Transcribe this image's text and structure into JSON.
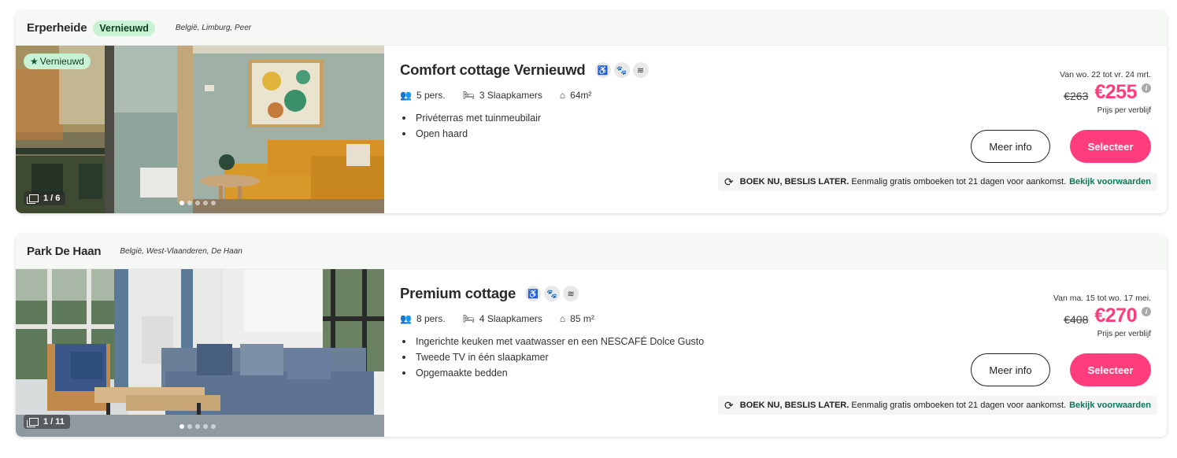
{
  "listings": [
    {
      "park_name": "Erperheide",
      "park_badge": "Vernieuwd",
      "location": [
        "België",
        "Limburg",
        "Peer"
      ],
      "photo_badge": "Vernieuwd",
      "photo_counter": "1 / 6",
      "title": "Comfort cottage Vernieuwd",
      "amenity_icons": [
        "wheelchair-icon",
        "pet-paw-icon",
        "wifi-icon"
      ],
      "persons": "5 pers.",
      "bedrooms": "3 Slaapkamers",
      "area": "64m²",
      "features": [
        "Privéterras met tuinmeubilair",
        "Open haard"
      ],
      "dates": "Van wo. 22 tot vr. 24 mrt.",
      "old_price": "€263",
      "new_price": "€255",
      "per_stay": "Prijs per verblijf",
      "more_info": "Meer info",
      "select": "Selecteer",
      "book_bold": "BOEK NU, BESLIS LATER.",
      "book_text": "Eenmalig gratis omboeken tot 21 dagen voor aankomst.",
      "book_link": "Bekijk voorwaarden"
    },
    {
      "park_name": "Park De Haan",
      "location": [
        "België",
        "West-Vlaanderen",
        "De Haan"
      ],
      "photo_counter": "1 / 11",
      "title": "Premium cottage",
      "amenity_icons": [
        "wheelchair-icon",
        "pet-paw-icon",
        "wifi-icon"
      ],
      "persons": "8 pers.",
      "bedrooms": "4 Slaapkamers",
      "area": "85 m²",
      "features": [
        "Ingerichte keuken met vaatwasser en een NESCAFÉ Dolce Gusto",
        "Tweede TV in één slaapkamer",
        "Opgemaakte bedden"
      ],
      "dates": "Van ma. 15 tot wo. 17 mei.",
      "old_price": "€408",
      "new_price": "€270",
      "per_stay": "Prijs per verblijf",
      "more_info": "Meer info",
      "select": "Selecteer",
      "book_bold": "BOEK NU, BESLIS LATER.",
      "book_text": "Eenmalig gratis omboeken tot 21 dagen voor aankomst.",
      "book_link": "Bekijk voorwaarden"
    }
  ],
  "colors": {
    "accent_pink": "#ff3d7c",
    "badge_green": "#c9f1d4",
    "link_green": "#0a7a5a"
  }
}
